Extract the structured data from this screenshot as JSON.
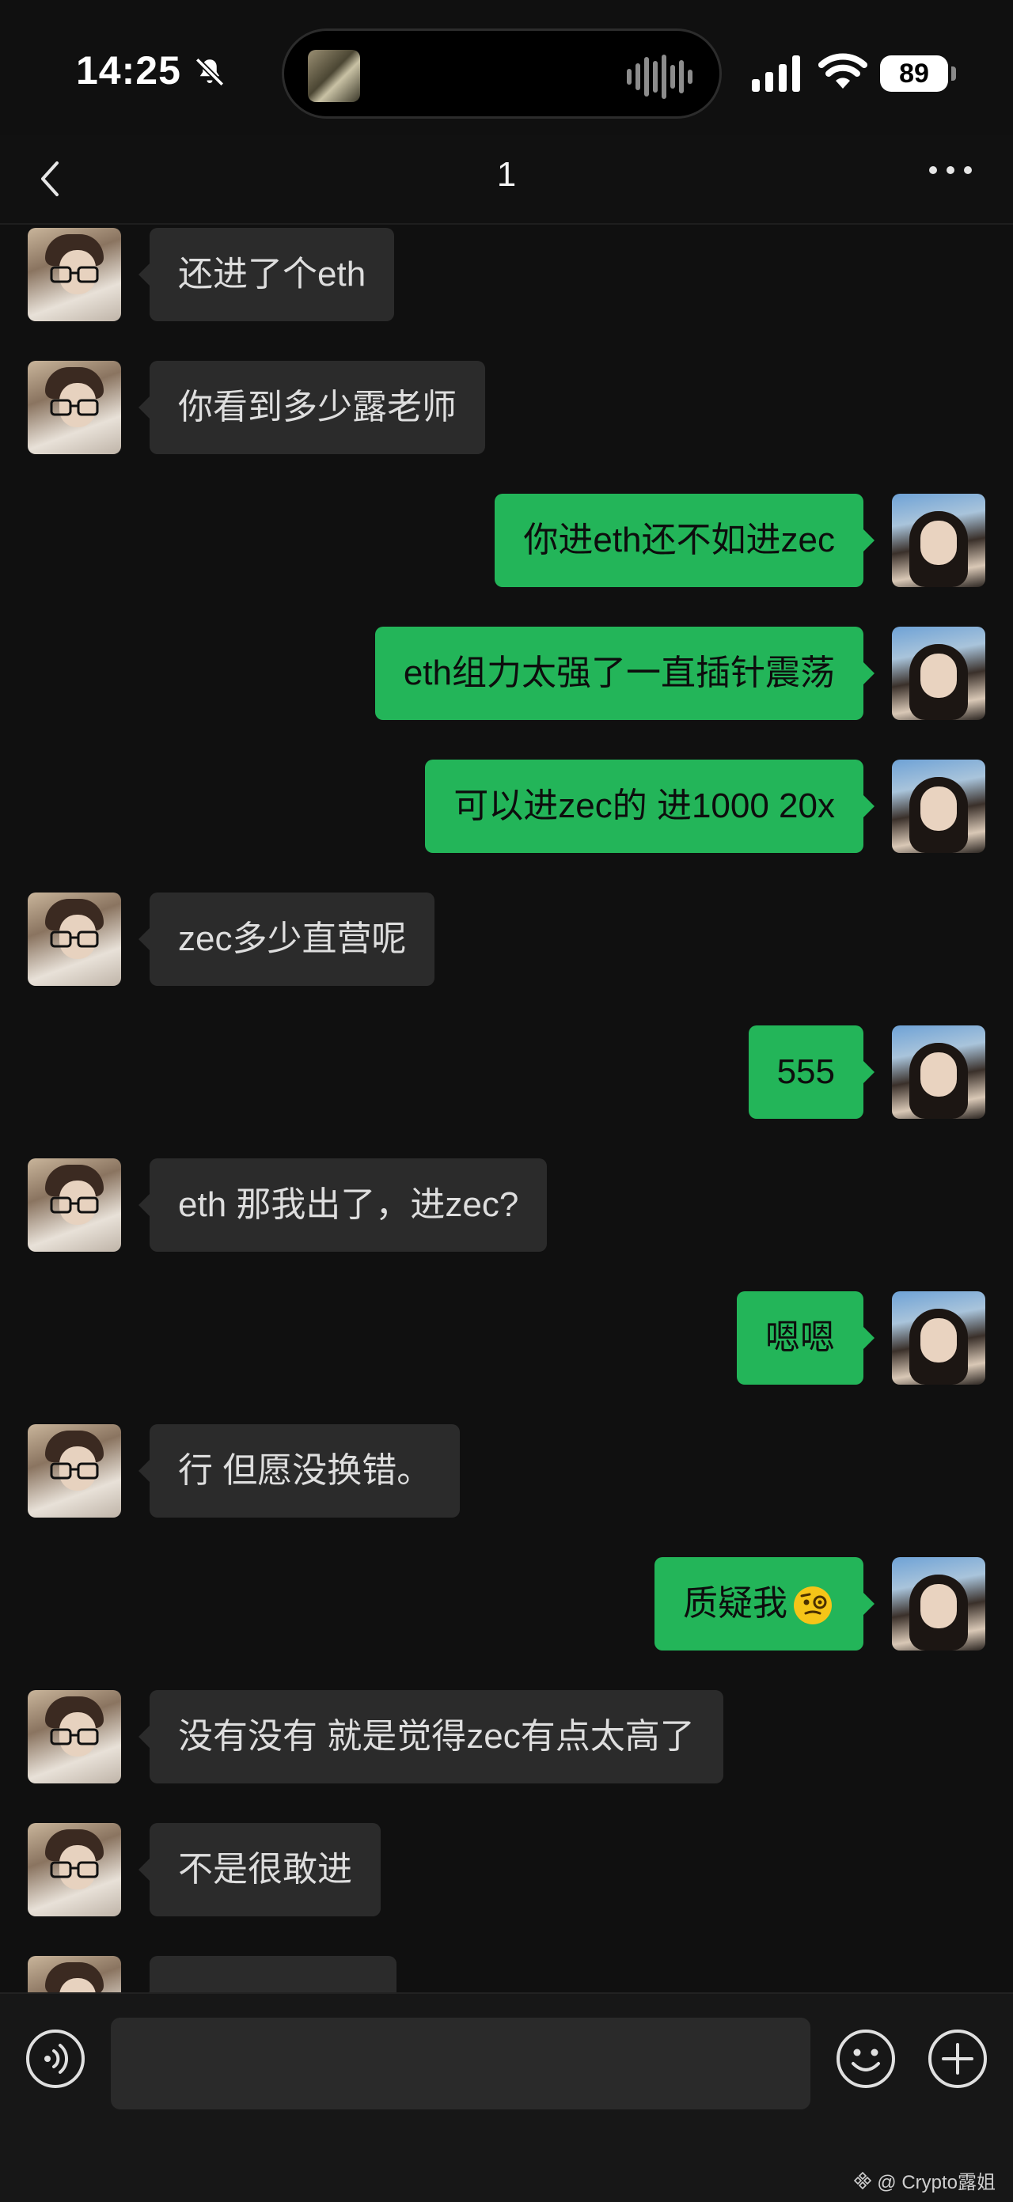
{
  "status": {
    "time": "14:25",
    "battery": "89"
  },
  "nav": {
    "title": "1"
  },
  "messages": [
    {
      "side": "in",
      "text": "还进了个eth"
    },
    {
      "side": "in",
      "text": "你看到多少露老师"
    },
    {
      "side": "out",
      "text": "你进eth还不如进zec"
    },
    {
      "side": "out",
      "text": "eth组力太强了一直插针震荡"
    },
    {
      "side": "out",
      "text": "可以进zec的 进1000 20x"
    },
    {
      "side": "in",
      "text": "zec多少直营呢"
    },
    {
      "side": "out",
      "text": "555"
    },
    {
      "side": "in",
      "text": "eth 那我出了，进zec?"
    },
    {
      "side": "out",
      "text": "嗯嗯"
    },
    {
      "side": "in",
      "text": "行 但愿没换错。"
    },
    {
      "side": "out",
      "text": "质疑我",
      "emoji": "face-with-monocle"
    },
    {
      "side": "in",
      "text": "没有没有 就是觉得zec有点太高了"
    },
    {
      "side": "in",
      "text": "不是很敢进"
    },
    {
      "side": "in",
      "text": ""
    }
  ],
  "input": {
    "value": ""
  },
  "watermark": {
    "text": "@ Crypto露姐"
  },
  "colors": {
    "background": "#101010",
    "incoming_bubble": "#2b2b2b",
    "outgoing_bubble": "#23b559"
  }
}
